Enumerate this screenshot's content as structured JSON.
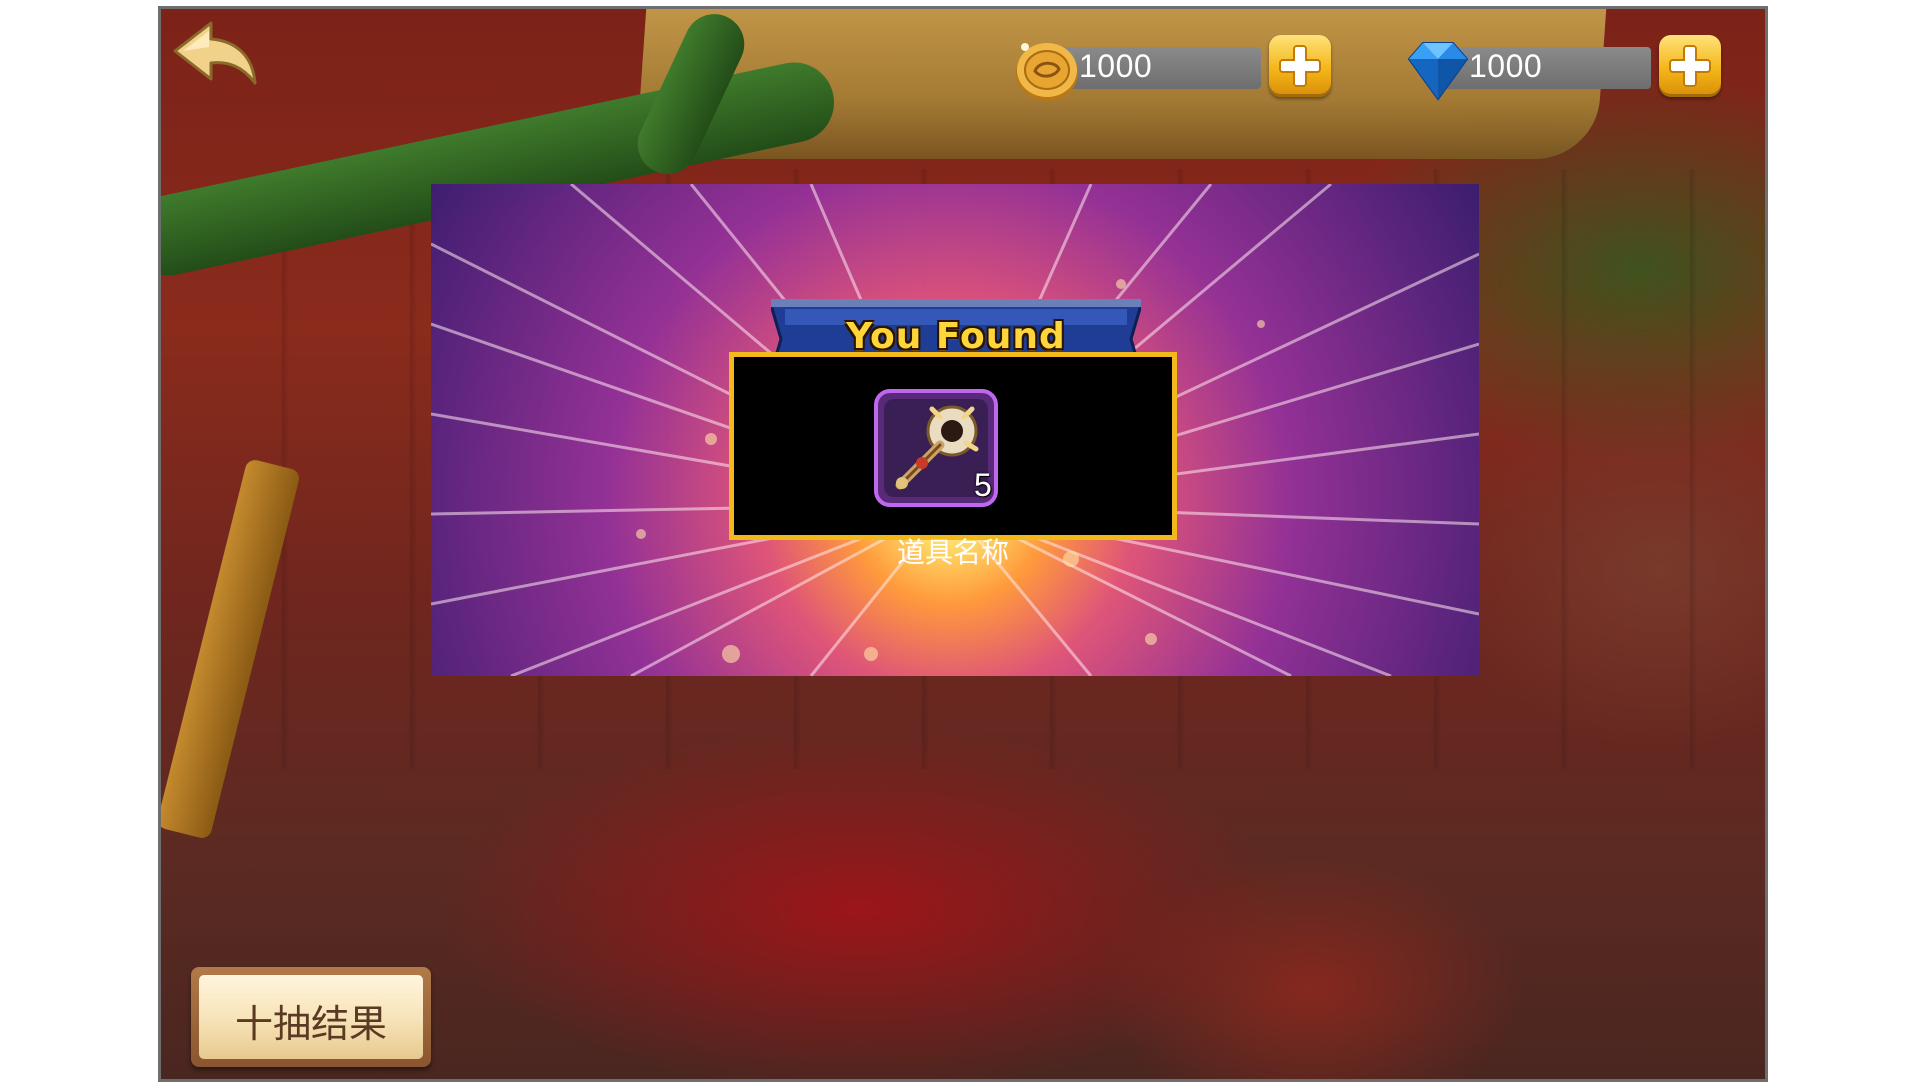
{
  "top_bar": {
    "back_icon": "back-arrow-icon",
    "coin": {
      "icon": "coin-icon",
      "value": "1000",
      "add_icon": "plus-icon"
    },
    "gem": {
      "icon": "diamond-icon",
      "value": "1000",
      "add_icon": "plus-icon"
    }
  },
  "reward_panel": {
    "banner_text": "You Found",
    "item": {
      "icon": "hammer-item-icon",
      "count": "5",
      "name": "道具名称"
    }
  },
  "ten_draw_button": {
    "label": "十抽结果"
  },
  "colors": {
    "accent_gold": "#f2b91c",
    "banner_blue": "#1e3a8c",
    "item_frame_purple": "#b04de0",
    "panel_purple": "#6a2a9a"
  }
}
